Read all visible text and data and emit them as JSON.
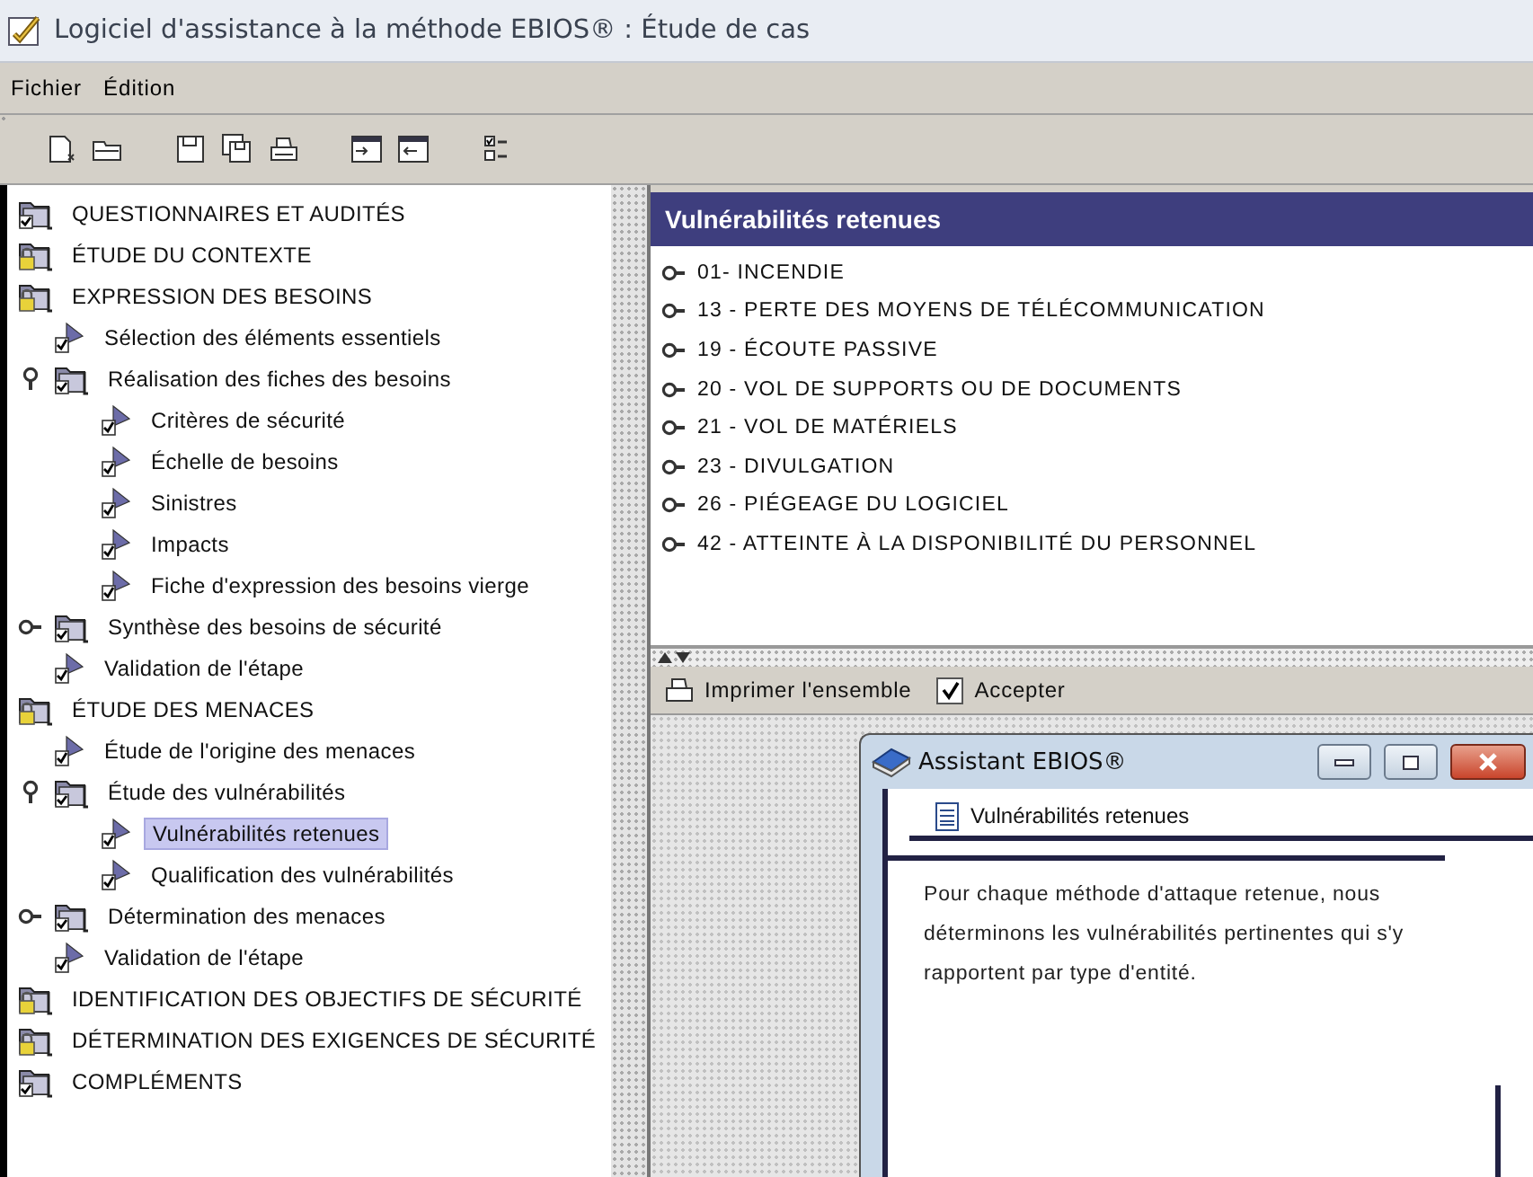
{
  "window": {
    "title": "Logiciel d'assistance à la méthode EBIOS® : Étude de cas"
  },
  "menu": [
    {
      "label": "Fichier"
    },
    {
      "label": "Édition"
    }
  ],
  "toolbar": [
    {
      "kind": "new"
    },
    {
      "kind": "open"
    },
    {
      "kind": "gap"
    },
    {
      "kind": "save"
    },
    {
      "kind": "save-all"
    },
    {
      "kind": "print"
    },
    {
      "kind": "gap"
    },
    {
      "kind": "import"
    },
    {
      "kind": "export"
    },
    {
      "kind": "gap"
    },
    {
      "kind": "checklist"
    }
  ],
  "tree": [
    {
      "label": "QUESTIONNAIRES ET AUDITÉS",
      "kind": "folder",
      "selected": false
    },
    {
      "label": "ÉTUDE DU CONTEXTE",
      "kind": "locked",
      "selected": false
    },
    {
      "label": "EXPRESSION DES BESOINS",
      "kind": "locked",
      "selected": false,
      "children": [
        {
          "label": "Sélection des éléments essentiels",
          "kind": "step",
          "selected": false
        },
        {
          "label": "Réalisation des fiches des besoins",
          "kind": "folder",
          "selected": false,
          "expanded": true,
          "children": [
            {
              "label": "Critères de sécurité",
              "kind": "step",
              "selected": false
            },
            {
              "label": "Échelle de besoins",
              "kind": "step",
              "selected": false
            },
            {
              "label": "Sinistres",
              "kind": "step",
              "selected": false
            },
            {
              "label": "Impacts",
              "kind": "step",
              "selected": false
            },
            {
              "label": "Fiche d'expression des besoins vierge",
              "kind": "step",
              "selected": false
            }
          ]
        },
        {
          "label": "Synthèse des besoins de sécurité",
          "kind": "folder",
          "selected": false,
          "expanded": false
        },
        {
          "label": "Validation de l'étape",
          "kind": "step",
          "selected": false
        }
      ]
    },
    {
      "label": "ÉTUDE DES MENACES",
      "kind": "locked",
      "selected": false,
      "children": [
        {
          "label": "Étude de l'origine des menaces",
          "kind": "step",
          "selected": false
        },
        {
          "label": "Étude des vulnérabilités",
          "kind": "folder",
          "selected": false,
          "expanded": true,
          "children": [
            {
              "label": "Vulnérabilités retenues",
              "kind": "step",
              "selected": true
            },
            {
              "label": "Qualification des vulnérabilités",
              "kind": "step",
              "selected": false
            }
          ]
        },
        {
          "label": "Détermination des menaces",
          "kind": "folder",
          "selected": false,
          "expanded": false
        },
        {
          "label": "Validation de l'étape",
          "kind": "step",
          "selected": false
        }
      ]
    },
    {
      "label": "IDENTIFICATION DES OBJECTIFS DE SÉCURITÉ",
      "kind": "locked",
      "selected": false
    },
    {
      "label": "DÉTERMINATION DES EXIGENCES DE SÉCURITÉ",
      "kind": "locked",
      "selected": false
    },
    {
      "label": "COMPLÉMENTS",
      "kind": "folder",
      "selected": false
    }
  ],
  "panel": {
    "title": "Vulnérabilités retenues",
    "items": [
      {
        "label": "01- INCENDIE"
      },
      {
        "label": "13 - PERTE DES MOYENS DE TÉLÉCOMMUNICATION"
      },
      {
        "label": "19 - ÉCOUTE PASSIVE"
      },
      {
        "label": "20 - VOL DE SUPPORTS OU DE DOCUMENTS"
      },
      {
        "label": "21 - VOL DE MATÉRIELS"
      },
      {
        "label": "23 - DIVULGATION"
      },
      {
        "label": "26 - PIÉGEAGE DU LOGICIEL"
      },
      {
        "label": "42 - ATTEINTE À LA DISPONIBILITÉ DU PERSONNEL"
      }
    ]
  },
  "actions": {
    "print": "Imprimer l'ensemble",
    "accept": {
      "label": "Accepter",
      "checked": true
    }
  },
  "assistant": {
    "title": "Assistant EBIOS®",
    "tab": "Vulnérabilités retenues",
    "text": "Pour chaque méthode d'attaque retenue, nous déterminons les vulnérabilités pertinentes qui s'y rapportent par type d'entité."
  }
}
